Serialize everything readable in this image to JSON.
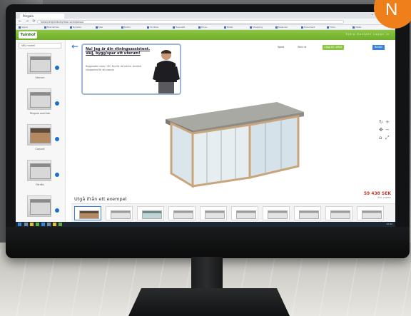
{
  "browser": {
    "tab_title": "Pergola",
    "address": "www.pergolakalkylator.se/anpassa",
    "bookmarks": [
      "Appar",
      "Bokmärken",
      "Nyheter",
      "Mail",
      "Kartor",
      "YouTube",
      "Översätt",
      "Drive",
      "Bilder",
      "Shopping",
      "Kalender",
      "Dokument",
      "Foton",
      "Väder"
    ]
  },
  "app": {
    "logo_text": "Tuinhof",
    "nav_links": "Hjälp   Kontakt   Logga in"
  },
  "sidebar": {
    "select_label": "Välj modell",
    "items": [
      {
        "label": "Uterum"
      },
      {
        "label": "Pergola med tak"
      },
      {
        "label": "Carport"
      },
      {
        "label": "Förråd"
      }
    ]
  },
  "info_card": {
    "title": "Nu! Jag är din ritningsassistent. Välj, bygg/spar ett uterum!",
    "body": "Byggnaden visas i 3D. Dra för att rotera. Använd knapparna för att zooma."
  },
  "toolbar": {
    "btn1": "Spara",
    "btn2": "Skriv ut",
    "btn3": "Lägg till i offert",
    "btn4": "Beställ"
  },
  "price": {
    "main": "59 438 SEK",
    "sub": "inkl. moms"
  },
  "examples": {
    "title": "Utgå ifrån ett exempel"
  },
  "taskbar": {
    "clock": "10:42"
  },
  "badge": {
    "letter": "N"
  },
  "colors": {
    "accent_green": "#8cc642",
    "accent_blue": "#3b82d6",
    "badge_orange": "#ef7f1a",
    "price_red": "#c0392b"
  }
}
